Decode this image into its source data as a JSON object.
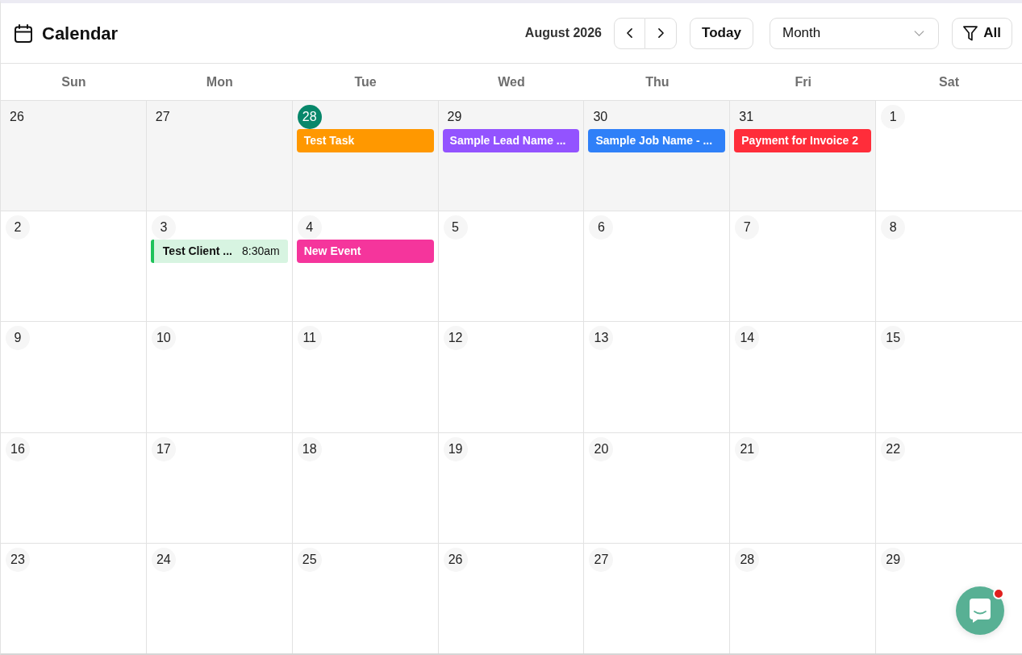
{
  "header": {
    "title": "Calendar",
    "period": "August 2026",
    "today_button": "Today",
    "view_select": {
      "value": "Month"
    },
    "filter_button": "All"
  },
  "weekdays": [
    "Sun",
    "Mon",
    "Tue",
    "Wed",
    "Thu",
    "Fri",
    "Sat"
  ],
  "weeks": [
    {
      "days": [
        {
          "date": "26",
          "outside": true,
          "today": false
        },
        {
          "date": "27",
          "outside": true,
          "today": false
        },
        {
          "date": "28",
          "outside": true,
          "today": true,
          "events": [
            {
              "kind": "bar",
              "title": "Test Task",
              "color": "#ff9800"
            }
          ]
        },
        {
          "date": "29",
          "outside": true,
          "today": false,
          "events": [
            {
              "kind": "bar",
              "title": "Sample Lead Name ...",
              "color": "#9353ff"
            }
          ]
        },
        {
          "date": "30",
          "outside": true,
          "today": false,
          "events": [
            {
              "kind": "bar",
              "title": "Sample Job Name - ...",
              "color": "#2f80f8"
            }
          ]
        },
        {
          "date": "31",
          "outside": true,
          "today": false,
          "events": [
            {
              "kind": "bar",
              "title": "Payment for Invoice 2",
              "color": "#ff2d3a"
            }
          ]
        },
        {
          "date": "1",
          "outside": false,
          "today": false
        }
      ]
    },
    {
      "days": [
        {
          "date": "2",
          "outside": false,
          "today": false
        },
        {
          "date": "3",
          "outside": false,
          "today": false,
          "events": [
            {
              "kind": "timed",
              "title": "Test Client ...",
              "time": "8:30am",
              "color": "#1ec25a"
            }
          ]
        },
        {
          "date": "4",
          "outside": false,
          "today": false,
          "events": [
            {
              "kind": "bar",
              "title": "New Event",
              "color": "#f5359c"
            }
          ]
        },
        {
          "date": "5",
          "outside": false,
          "today": false
        },
        {
          "date": "6",
          "outside": false,
          "today": false
        },
        {
          "date": "7",
          "outside": false,
          "today": false
        },
        {
          "date": "8",
          "outside": false,
          "today": false
        }
      ]
    },
    {
      "days": [
        {
          "date": "9",
          "outside": false,
          "today": false
        },
        {
          "date": "10",
          "outside": false,
          "today": false
        },
        {
          "date": "11",
          "outside": false,
          "today": false
        },
        {
          "date": "12",
          "outside": false,
          "today": false
        },
        {
          "date": "13",
          "outside": false,
          "today": false
        },
        {
          "date": "14",
          "outside": false,
          "today": false
        },
        {
          "date": "15",
          "outside": false,
          "today": false
        }
      ]
    },
    {
      "days": [
        {
          "date": "16",
          "outside": false,
          "today": false
        },
        {
          "date": "17",
          "outside": false,
          "today": false
        },
        {
          "date": "18",
          "outside": false,
          "today": false
        },
        {
          "date": "19",
          "outside": false,
          "today": false
        },
        {
          "date": "20",
          "outside": false,
          "today": false
        },
        {
          "date": "21",
          "outside": false,
          "today": false
        },
        {
          "date": "22",
          "outside": false,
          "today": false
        }
      ]
    },
    {
      "days": [
        {
          "date": "23",
          "outside": false,
          "today": false
        },
        {
          "date": "24",
          "outside": false,
          "today": false
        },
        {
          "date": "25",
          "outside": false,
          "today": false
        },
        {
          "date": "26",
          "outside": false,
          "today": false
        },
        {
          "date": "27",
          "outside": false,
          "today": false
        },
        {
          "date": "28",
          "outside": false,
          "today": false
        },
        {
          "date": "29",
          "outside": false,
          "today": false
        }
      ]
    }
  ],
  "chat_launcher": {
    "unread": true
  }
}
